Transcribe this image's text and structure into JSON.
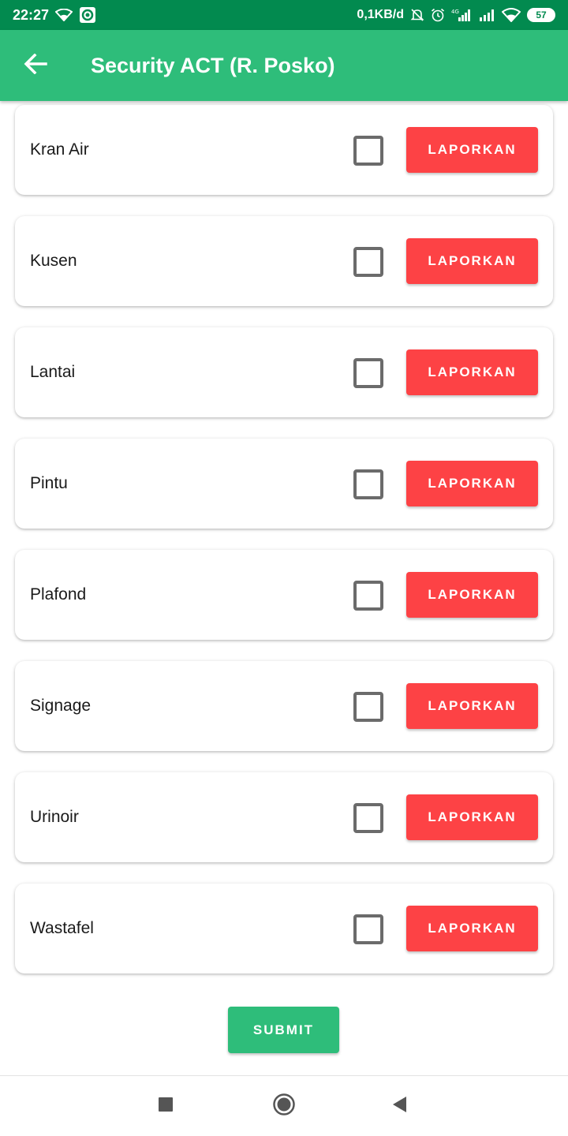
{
  "status_bar": {
    "time": "22:27",
    "network_speed": "0,1KB/d",
    "battery": "57",
    "icons": [
      "wifi-icon",
      "app-notification-icon",
      "mute-icon",
      "alarm-icon",
      "signal-4g-icon",
      "signal-icon",
      "wifi-icon",
      "battery-icon"
    ]
  },
  "app_bar": {
    "title": "Security ACT (R. Posko)",
    "back_icon": "arrow-left-icon"
  },
  "items": [
    {
      "label": "Kran Air",
      "button": "LAPORKAN",
      "checked": false
    },
    {
      "label": "Kusen",
      "button": "LAPORKAN",
      "checked": false
    },
    {
      "label": "Lantai",
      "button": "LAPORKAN",
      "checked": false
    },
    {
      "label": "Pintu",
      "button": "LAPORKAN",
      "checked": false
    },
    {
      "label": "Plafond",
      "button": "LAPORKAN",
      "checked": false
    },
    {
      "label": "Signage",
      "button": "LAPORKAN",
      "checked": false
    },
    {
      "label": "Urinoir",
      "button": "LAPORKAN",
      "checked": false
    },
    {
      "label": "Wastafel",
      "button": "LAPORKAN",
      "checked": false
    }
  ],
  "submit_label": "SUBMIT",
  "nav_bar": {
    "icons": [
      "recents-square-icon",
      "home-circle-icon",
      "back-triangle-icon"
    ]
  },
  "colors": {
    "status_bar": "#028a4f",
    "app_bar": "#2ebd7a",
    "report_button": "#fd4245",
    "submit_button": "#2ebd7a"
  }
}
